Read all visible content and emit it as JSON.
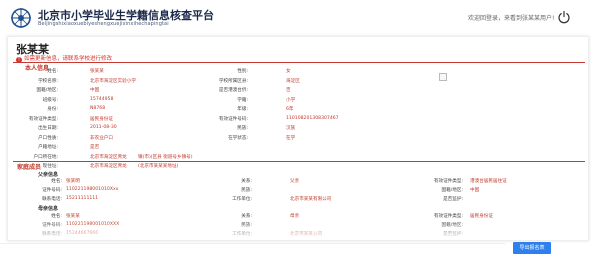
{
  "header": {
    "title": "北京市小学毕业生学籍信息核查平台",
    "subtitle": "Beijingshixiaoxuebiyeshengxuejixinxihechapingtai",
    "welcome": "欢迎回登录，来看到张某某用户!"
  },
  "student": {
    "name_heading": "张某某",
    "notice": "如需更新信息，请联系学校进行修改"
  },
  "basic": {
    "section_title": "本人信息",
    "fields": [
      {
        "label": "姓名:",
        "value": "张某某"
      },
      {
        "label": "性别:",
        "value": "女"
      },
      {
        "label": "学校名称:",
        "value": "北京市海淀区实验小学"
      },
      {
        "label": "学校所属区县:",
        "value": "海淀区"
      },
      {
        "label": "国籍/地区:",
        "value": "中国"
      },
      {
        "label": "是否港澳台侨:",
        "value": "否"
      },
      {
        "label": "班级号:",
        "value": "15744958"
      },
      {
        "label": "学籍:",
        "value": "小学"
      },
      {
        "label": "身份:",
        "value": "N8768"
      },
      {
        "label": "年级:",
        "value": "6年"
      },
      {
        "label": "有效证件类型:",
        "value": "居民身份证"
      },
      {
        "label": "有效证件号码:",
        "value": "110108201308307467"
      },
      {
        "label": "出生日期:",
        "value": "2011-08-30"
      },
      {
        "label": "民族:",
        "value": "汉族"
      },
      {
        "label": "户口性质:",
        "value": "非农业户口"
      },
      {
        "label": "在学状态:",
        "value": "在学"
      },
      {
        "label": "户籍地址:",
        "value": "是否"
      },
      {
        "label": "户口所在地:",
        "value": "北京市海淀区青龙",
        "extra": "镇(市)(区县 街道号乡镇号)"
      },
      {
        "label": "现住址:",
        "value": "北京市海淀区青龙",
        "extra": "(北京市某某某地址)"
      }
    ]
  },
  "family": {
    "section_title": "家庭成员",
    "father": {
      "title": "父亲信息",
      "fields": [
        {
          "label": "姓名:",
          "value": "张某明"
        },
        {
          "label": "关系:",
          "value": "父亲"
        },
        {
          "label": "有效证件类型:",
          "value": "港澳台居民居住证"
        },
        {
          "label": "证件号码:",
          "value": "110221198001010Xxx"
        },
        {
          "label": "民族:",
          "value": ""
        },
        {
          "label": "国籍/地区:",
          "value": "中国"
        },
        {
          "label": "联系电话:",
          "value": "15211111111"
        },
        {
          "label": "工作单位:",
          "value": "北京市某某有限公司"
        },
        {
          "label": "是否监护:",
          "value": ""
        }
      ]
    },
    "mother": {
      "title": "母亲信息",
      "fields": [
        {
          "label": "姓名:",
          "value": "张某某"
        },
        {
          "label": "关系:",
          "value": "母亲"
        },
        {
          "label": "有效证件类型:",
          "value": "居民身份证"
        },
        {
          "label": "证件号码:",
          "value": "110221198001010XXX"
        },
        {
          "label": "民族:",
          "value": ""
        },
        {
          "label": "国籍/地区:",
          "value": ""
        },
        {
          "label": "联系电话:",
          "value": "15244667666"
        },
        {
          "label": "工作单位:",
          "value": "北京市某某公司"
        },
        {
          "label": "是否监护:",
          "value": ""
        }
      ]
    }
  },
  "actions": {
    "export_label": "导出报名表"
  }
}
